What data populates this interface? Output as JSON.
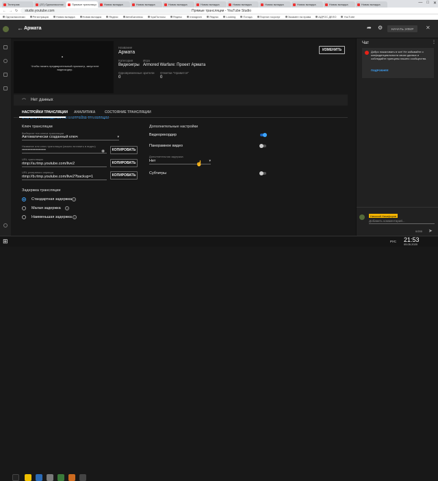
{
  "browser": {
    "tabs": [
      "Телеграм",
      "(37) Одноклассник",
      "Прямые трансляци",
      "Новая вкладка",
      "Новая вкладка",
      "Новая вкладка",
      "Новая вкладка",
      "Новая вкладка",
      "Новая вкладка",
      "Новая вкладка",
      "Новая вкладка",
      "Новая вкладка"
    ],
    "active_tab": 2,
    "url": "studio.youtube.com",
    "window_title": "Прямые трансляции - YouTube Studio",
    "bookmarks": [
      "Одноклассники",
      "Регистрация",
      "Новая вкладка",
      "Новая вкладка",
      "Яндекс",
      "АвтоБалансы",
      "ЧужПолосы",
      "Яндекс",
      "Instagram",
      "Яндекс",
      "Looking",
      "Погода",
      "Портал госуслуг",
      "Экзамен на права",
      "АДРОС ДЕЛО",
      "YouTube"
    ]
  },
  "header": {
    "title": "Армата",
    "start_button": "НАЧАТЬ ЭФИР"
  },
  "preview": {
    "placeholder_text": "Чтобы начать предварительный просмотр, запустите видеокодер.",
    "guide_link": "ОТКРЫТЬ РУКОВОДСТВО ПО НАСТРОЙКЕ ТРАНСЛЯЦИИ"
  },
  "info": {
    "name_label": "Название",
    "name_value": "Армата",
    "category_label": "Категория",
    "category_value": "Видеоигры",
    "game_label": "Игра",
    "game_value": "Armored Warfare: Проект Армата",
    "viewers_label": "Одновременные зрители",
    "viewers_value": "0",
    "likes_label": "Отметки \"Нравится\"",
    "likes_value": "0",
    "edit_button": "ИЗМЕНИТЬ"
  },
  "status": {
    "text": "Нет данных"
  },
  "tabs": [
    "НАСТРОЙКИ ТРАНСЛЯЦИИ",
    "АНАЛИТИКА",
    "СОСТОЯНИЕ ТРАНСЛЯЦИИ"
  ],
  "stream_key": {
    "section_title": "Ключ трансляции",
    "select_label": "Выберите тип ключа трансляции",
    "select_value": "Автоматически созданный ключ",
    "key_label": "Название или ключ трансляции (можно вставить в видео)",
    "key_value": "••••••••••••••••••••",
    "copy": "КОПИРОВАТЬ",
    "url_label": "URL трансляции",
    "url_value": "rtmp://a.rtmp.youtube.com/live2",
    "backup_label": "URL резервного сервера",
    "backup_value": "rtmp://b.rtmp.youtube.com/live2?backup=1"
  },
  "latency": {
    "section_title": "Задержка трансляции",
    "options": [
      "Стандартная задержка",
      "Малая задержка",
      "Наименьшая задержка"
    ],
    "selected": 0
  },
  "extra": {
    "section_title": "Дополнительные настройки",
    "dvr": "Видеорекордер",
    "dvr_on": true,
    "panorama": "Панорамное видео",
    "panorama_on": false,
    "delay_label": "Дополнительная задержка",
    "delay_value": "Нет",
    "subtitles": "Субтитры",
    "subtitles_on": false
  },
  "chat": {
    "title": "Чат",
    "notice": "Добро пожаловать в чат! Не забывайте о конфиденциальности своих данных и соблюдайте принципы нашего сообщества.",
    "notice_link": "ПОДРОБНЕЕ",
    "user_name": "Николай Никифоров",
    "input_placeholder": "Добавить комментарий...",
    "counter": "0/200"
  },
  "taskbar": {
    "lang": "РУС",
    "time": "21:53",
    "date": "05.05.2020"
  },
  "colors": {
    "accent": "#3ea6ff",
    "background": "#181818",
    "panel": "#282828",
    "chip": "#f4b400"
  }
}
